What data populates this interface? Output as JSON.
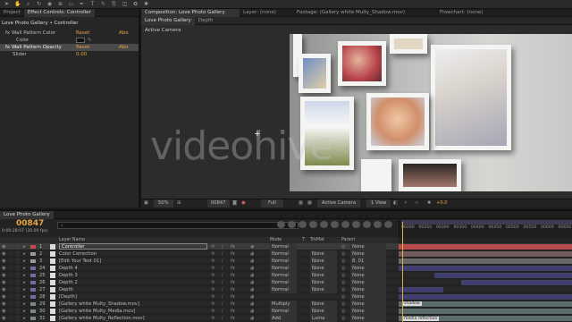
{
  "tools_icons": [
    "selection-icon",
    "hand-icon",
    "zoom-icon",
    "rotate-icon",
    "camera-icon",
    "pan-behind-icon",
    "rectangle-icon",
    "pen-icon",
    "text-icon",
    "brush-icon",
    "clone-icon",
    "eraser-icon",
    "roto-icon",
    "puppet-icon"
  ],
  "left_panel": {
    "tabs": [
      "Project",
      "Effect Controls: Controller"
    ],
    "path": "Love Photo Gallery • Controller",
    "rows": [
      {
        "name": "fx Wall Pattern Color",
        "reset": "Reset",
        "about": "Abo"
      },
      {
        "name": "Color"
      },
      {
        "name": "fx Wall Pattern Opacity",
        "reset": "Reset",
        "about": "Abo"
      },
      {
        "name": "Slider",
        "value": "0.00"
      }
    ]
  },
  "comp_panel": {
    "tabs": [
      "Composition: Love Photo Gallery",
      "Layer: (none)",
      "Footage: (Gallery white Multy_Shadow.mov)",
      "Flowchart: (none)"
    ],
    "subtabs": [
      "Love Photo Gallery",
      "Depth"
    ],
    "view_label": "Active Camera",
    "watermark": "videohive",
    "footer": {
      "zoom": "50%",
      "timecode": "00847",
      "quality": "Full",
      "camera": "Active Camera",
      "views": "1 View",
      "exposure": "+0.0"
    }
  },
  "timeline": {
    "tab": "Love Photo Gallery",
    "timecode": "00847",
    "subtime": "0:00:28:07 (30.00 fps)",
    "ruler": [
      "00200",
      "00250",
      "00300",
      "00350",
      "00400",
      "00450",
      "00500",
      "00550",
      "00600",
      "00650"
    ],
    "headers": {
      "layer_name": "Layer Name",
      "mode": "Mode",
      "t": "T",
      "trkmat": "TrkMat",
      "parent": "Parent"
    },
    "layers": [
      {
        "num": "1",
        "name": "Controller",
        "mode": "Normal",
        "trkmat": "",
        "parent": "None",
        "color": "#c24a4a"
      },
      {
        "num": "2",
        "name": "Color Correction",
        "mode": "Normal",
        "trkmat": "None",
        "parent": "None",
        "color": "#9a9a9a"
      },
      {
        "num": "3",
        "name": "[Edit Your Text 01]",
        "mode": "Normal",
        "trkmat": "None",
        "parent": "8. 01",
        "color": "#9a9a9a"
      },
      {
        "num": "24",
        "name": "Depth 4",
        "mode": "Normal",
        "trkmat": "None",
        "parent": "None",
        "color": "#6d6d9c"
      },
      {
        "num": "25",
        "name": "Depth 3",
        "mode": "Normal",
        "trkmat": "None",
        "parent": "None",
        "color": "#6d6d9c"
      },
      {
        "num": "26",
        "name": "Depth 2",
        "mode": "Normal",
        "trkmat": "None",
        "parent": "None",
        "color": "#6d6d9c"
      },
      {
        "num": "27",
        "name": "Depth",
        "mode": "Normal",
        "trkmat": "None",
        "parent": "None",
        "color": "#6d6d9c"
      },
      {
        "num": "28",
        "name": "[Depth]",
        "mode": "",
        "trkmat": "",
        "parent": "None",
        "color": "#6d6d9c"
      },
      {
        "num": "29",
        "name": "[Gallery white Multy_Shadow.mov]",
        "mode": "Multiply",
        "trkmat": "None",
        "parent": "None",
        "color": "#7a8a8a"
      },
      {
        "num": "30",
        "name": "[Gallery white Multy_Media.mov]",
        "mode": "Normal",
        "trkmat": "None",
        "parent": "None",
        "color": "#7a8a8a"
      },
      {
        "num": "31",
        "name": "[Gallery white Multy_Reflection.mov]",
        "mode": "Add",
        "trkmat": "Luma",
        "parent": "None",
        "color": "#7a8a8a"
      }
    ],
    "clip_labels": {
      "shadow": "shadow",
      "media_reflection": "media reflection"
    }
  },
  "colors": {
    "accent_orange": "#e4a73c",
    "layer_red": "#c24a4a",
    "layer_purple": "#6d6d9c",
    "timeline_blue": "#4a4a8a"
  }
}
